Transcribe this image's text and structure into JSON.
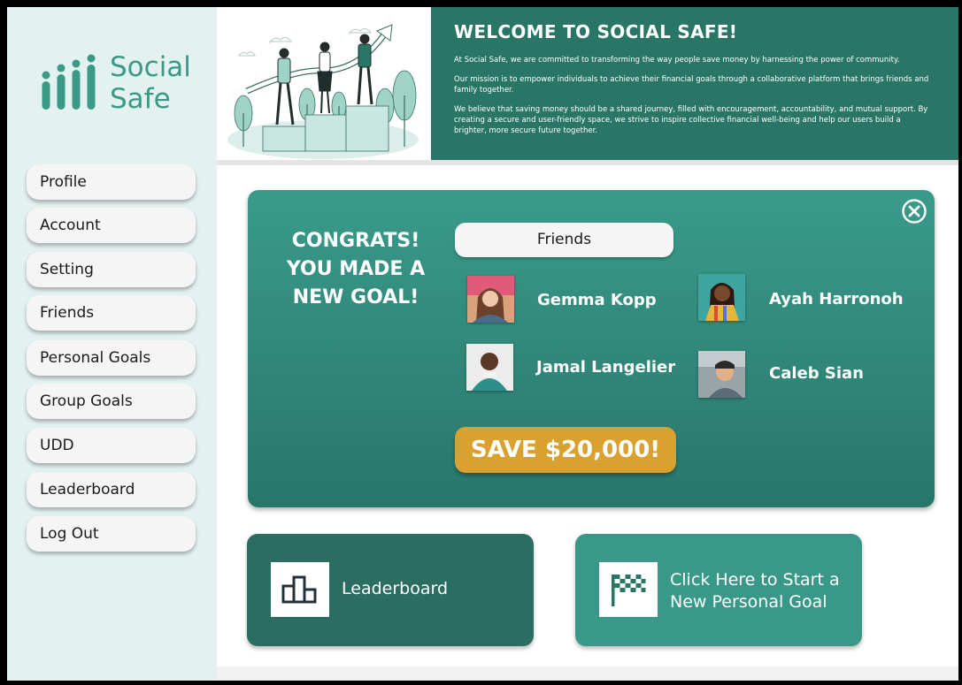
{
  "brand": {
    "line1": "Social",
    "line2": "Safe",
    "color": "#3a9a86"
  },
  "sidebar": {
    "items": [
      {
        "label": "Profile"
      },
      {
        "label": "Account"
      },
      {
        "label": "Setting"
      },
      {
        "label": "Friends"
      },
      {
        "label": "Personal Goals"
      },
      {
        "label": "Group Goals"
      },
      {
        "label": "UDD"
      },
      {
        "label": "Leaderboard"
      },
      {
        "label": "Log Out"
      }
    ]
  },
  "header": {
    "title": "WELCOME TO SOCIAL SAFE!",
    "paragraphs": [
      "At Social Safe, we are committed to transforming the way people save money by harnessing the power of community.",
      "Our mission is to empower individuals to achieve their financial goals through a collaborative platform that brings friends and family together.",
      "We believe that saving money should be a shared journey, filled with encouragement, accountability, and mutual support. By creating a secure and user-friendly space, we strive to inspire collective financial well-being and help our users build a brighter, more secure future together."
    ]
  },
  "congrats": {
    "title_line1": "CONGRATS!",
    "title_line2": "YOU MADE A",
    "title_line3": "NEW GOAL!",
    "friends_label": "Friends",
    "friends": [
      {
        "name": "Gemma Kopp"
      },
      {
        "name": "Ayah Harronoh"
      },
      {
        "name": "Jamal Langelier"
      },
      {
        "name": "Caleb Sian"
      }
    ],
    "save_label": "SAVE $20,000!"
  },
  "actions": {
    "leaderboard_label": "Leaderboard",
    "new_goal_line1": "Click Here to Start a",
    "new_goal_line2": "New Personal Goal"
  },
  "colors": {
    "primary_dark": "#2a7666",
    "primary_light": "#3a9889",
    "accent_gold": "#d9a230",
    "sidebar_bg": "#e3f1f0"
  }
}
